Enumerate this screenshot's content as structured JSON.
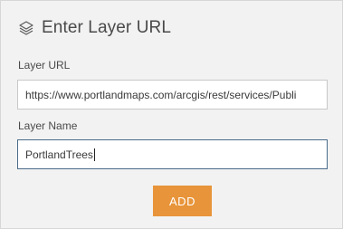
{
  "header": {
    "icon": "layers-icon",
    "title": "Enter Layer URL"
  },
  "layer_url": {
    "label": "Layer URL",
    "value": "https://www.portlandmaps.com/arcgis/rest/services/Publi"
  },
  "layer_name": {
    "label": "Layer Name",
    "value": "PortlandTrees"
  },
  "add_button": {
    "label": "ADD",
    "color": "#e8943a"
  }
}
